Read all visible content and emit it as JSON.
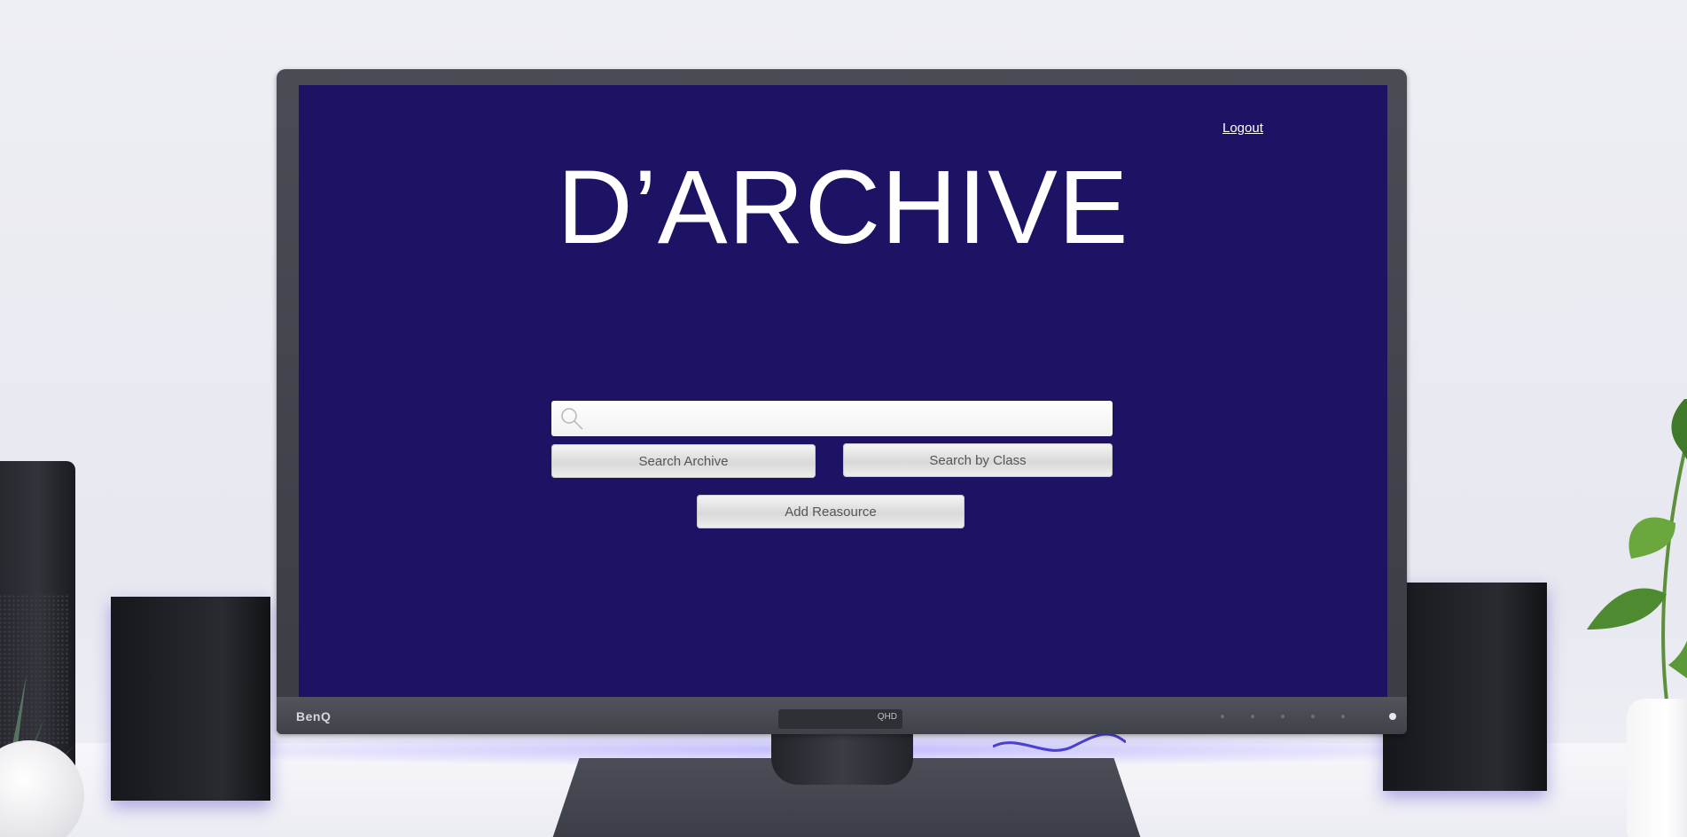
{
  "monitor": {
    "brand": "BenQ",
    "badge": "QHD"
  },
  "app": {
    "title": "D’ARCHIVE",
    "logout_label": "Logout",
    "search": {
      "value": "",
      "placeholder": ""
    },
    "buttons": {
      "search_archive": "Search Archive",
      "search_by_class": "Search by Class",
      "add_resource": "Add Reasource"
    }
  },
  "colors": {
    "screen_background": "#1c1364",
    "title_text": "#ffffff",
    "button_text": "#555555"
  },
  "icons": {
    "search": "search-icon"
  }
}
